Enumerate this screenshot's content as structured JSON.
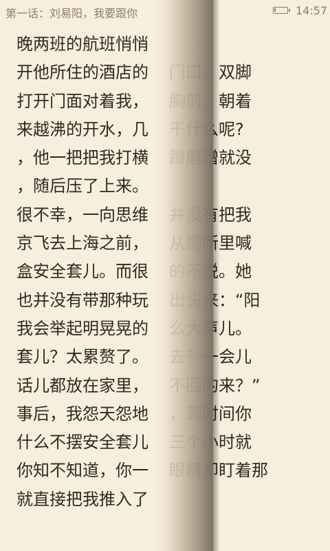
{
  "status_bar": {
    "chapter_title": "第一话：刘易阳，我要跟你",
    "battery_icon": "battery-low-icon",
    "time": "14:57"
  },
  "page": {
    "lines": [
      "晚两班的航班悄悄",
      "开他所住的酒店的",
      "打开门面对着我，",
      "来越沸的开水，几",
      "，他一把把我打横",
      "，随后压了上来。",
      "很不幸，一向思维",
      "京飞去上海之前，",
      "盒安全套儿。而很",
      "也并没有带那种玩",
      "我会举起明晃晃的",
      "套儿？太累赘了。",
      "话儿都放在家里，",
      "事后，我怨天怨地",
      "什么不摆安全套儿",
      "你知不知道，你一",
      "就直接把我推入了"
    ],
    "right_fragments": [
      "",
      "门口，双脚",
      "胸前，朝着",
      "干什么呢?",
      "蹭磨蹭就没",
      "",
      "并没有把我",
      "从厕所里喊",
      "的不悦。她",
      "出头来：“阳",
      "么大声儿。",
      "去？一会儿",
      "不回的来？”",
      "，到时间你",
      "三个小时就",
      "眼睛却盯着那",
      ""
    ]
  }
}
